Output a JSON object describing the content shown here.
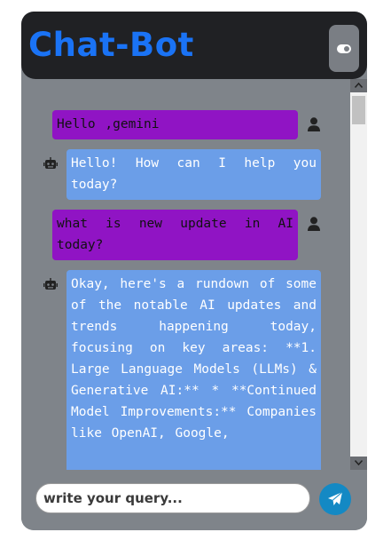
{
  "app": {
    "title": "Chat-Bot"
  },
  "colors": {
    "accent": "#1a73f5",
    "user_bubble": "#9014c4",
    "bot_bubble": "#6b9ee8",
    "send_button": "#1489c4"
  },
  "messages": [
    {
      "role": "user",
      "icon": "user-icon",
      "text": "Hello ,gemini"
    },
    {
      "role": "bot",
      "icon": "robot-icon",
      "text": "Hello! How can I help you today?"
    },
    {
      "role": "user",
      "icon": "user-icon",
      "text": "what is new update in AI today?"
    },
    {
      "role": "bot",
      "icon": "robot-icon",
      "text": "Okay, here's a rundown of some of the notable AI updates and trends happening today, focusing on key areas: **1. Large Language Models (LLMs) & Generative AI:** * **Continued Model Improvements:** Companies like OpenAI, Google,"
    }
  ],
  "composer": {
    "placeholder": "write your query...",
    "send_icon": "paper-plane-icon"
  },
  "theme_toggle_icon": "toggle-icon"
}
